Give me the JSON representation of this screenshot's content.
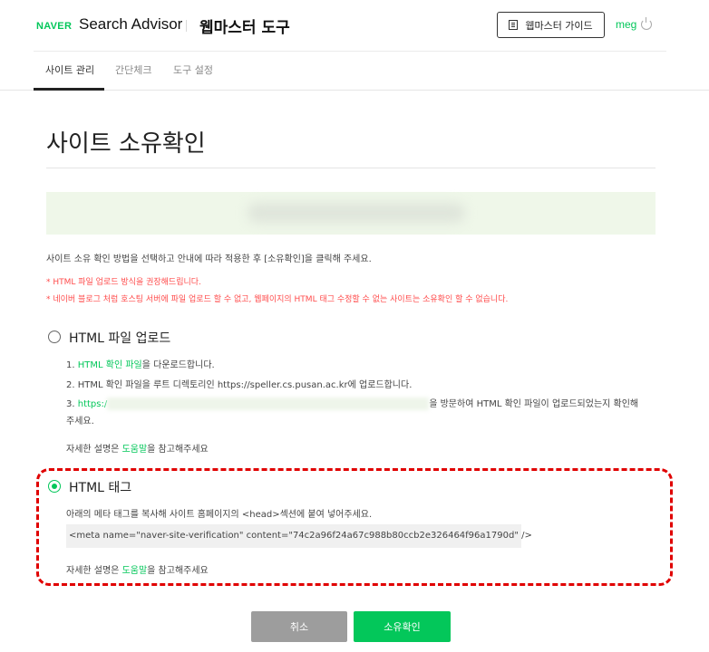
{
  "header": {
    "logo_naver": "NAVER",
    "logo_search_advisor": "Search Advisor",
    "logo_webmaster_tool": "웹마스터 도구",
    "guide_button": "웹마스터 가이드",
    "user_name": "meg"
  },
  "nav": {
    "tabs": [
      {
        "label": "사이트 관리",
        "active": true
      },
      {
        "label": "간단체크",
        "active": false
      },
      {
        "label": "도구 설정",
        "active": false
      }
    ]
  },
  "page": {
    "title": "사이트 소유확인",
    "intro": "사이트 소유 확인 방법을 선택하고 안내에 따라 적용한 후 [소유확인]을 클릭해 주세요.",
    "notes": [
      "* HTML 파일 업로드 방식을 권장해드립니다.",
      "* 네이버 블로그 처럼 호스팅 서버에 파일 업로드 할 수 없고, 웹페이지의 HTML 태그 수정할 수 없는 사이트는 소유확인 할 수 없습니다."
    ]
  },
  "options": {
    "file_upload": {
      "label": "HTML 파일 업로드",
      "selected": false,
      "step1_link": "HTML 확인 파일",
      "step1_prefix": "1. ",
      "step1_suffix": "을 다운로드합니다.",
      "step2": "2. HTML 확인 파일을 루트 디렉토리인 https://speller.cs.pusan.ac.kr에 업로드합니다.",
      "step3_prefix": "3. ",
      "step3_link": "https:/",
      "step3_suffix": "을 방문하여 HTML 확인 파일이 업로드되었는지 확인해",
      "step3_cont": "주세요.",
      "help_prefix": "자세한 설명은 ",
      "help_link": "도움말",
      "help_suffix": "을 참고해주세요"
    },
    "html_tag": {
      "label": "HTML 태그",
      "selected": true,
      "instruction": "아래의 메타 태그를 복사해 사이트 홈페이지의 <head>섹션에 붙여 넣어주세요.",
      "meta_tag": "<meta name=\"naver-site-verification\" content=\"74c2a96f24a67c988b80ccb2e326464f96a1790d\" />",
      "help_prefix": "자세한 설명은 ",
      "help_link": "도움말",
      "help_suffix": "을 참고해주세요"
    }
  },
  "buttons": {
    "cancel": "취소",
    "confirm": "소유확인"
  },
  "colors": {
    "brand_green": "#03c75a",
    "highlight_red": "#e00000",
    "notice_red": "#ff4b4b"
  }
}
